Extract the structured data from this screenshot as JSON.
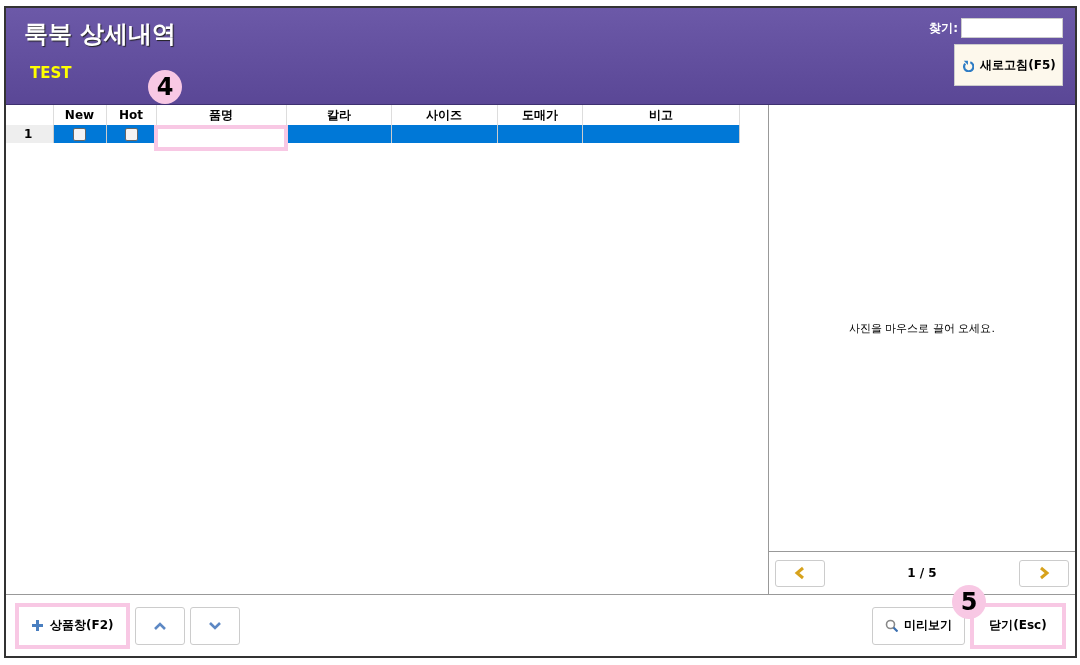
{
  "window": {
    "title": "룩북 상세내역",
    "subtitle": "TEST"
  },
  "search": {
    "label": "찾기:"
  },
  "refresh_button": {
    "label": "새로고침(F5)"
  },
  "table": {
    "columns": [
      "New",
      "Hot",
      "품명",
      "칼라",
      "사이즈",
      "도매가",
      "비고"
    ],
    "rows": [
      {
        "number": "1",
        "selected": true,
        "new": false,
        "hot": false,
        "cells": [
          {
            "focused": true
          },
          {
            "focused": false
          },
          {
            "focused": false
          },
          {
            "focused": false
          },
          {
            "focused": false
          }
        ]
      }
    ]
  },
  "photo_panel": {
    "hint": "사진을 마우스로 끌어 오세요.",
    "pager": "1 / 5"
  },
  "footer": {
    "add_button": "상품창(F2)",
    "preview_button": "미리보기",
    "close_button": "닫기(Esc)"
  },
  "callouts": [
    {
      "label": "4"
    },
    {
      "label": "5"
    }
  ]
}
